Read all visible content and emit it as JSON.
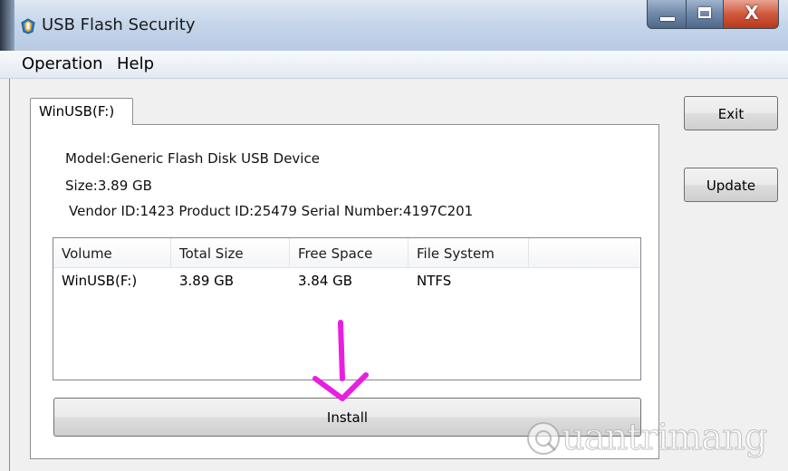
{
  "window": {
    "title": "USB Flash Security",
    "close_glyph": "X"
  },
  "menu": {
    "items": [
      "Operation",
      "Help"
    ]
  },
  "tab": {
    "label": "WinUSB(F:)"
  },
  "device": {
    "model": "Model:Generic Flash Disk USB Device",
    "size": "Size:3.89 GB",
    "ids": "Vendor ID:1423  Product ID:25479  Serial Number:4197C201"
  },
  "table": {
    "columns": [
      "Volume",
      "Total Size",
      "Free Space",
      "File System"
    ],
    "rows": [
      [
        "WinUSB(F:)",
        "3.89 GB",
        "3.84 GB",
        "NTFS"
      ]
    ]
  },
  "buttons": {
    "exit": "Exit",
    "update": "Update",
    "install": "Install"
  },
  "annotation": {
    "arrow_color": "#e81ee0"
  },
  "watermark": {
    "text": "uantrimang"
  },
  "colors": {
    "accent_close": "#c8462a",
    "titlebar": "#c6d6ea"
  }
}
